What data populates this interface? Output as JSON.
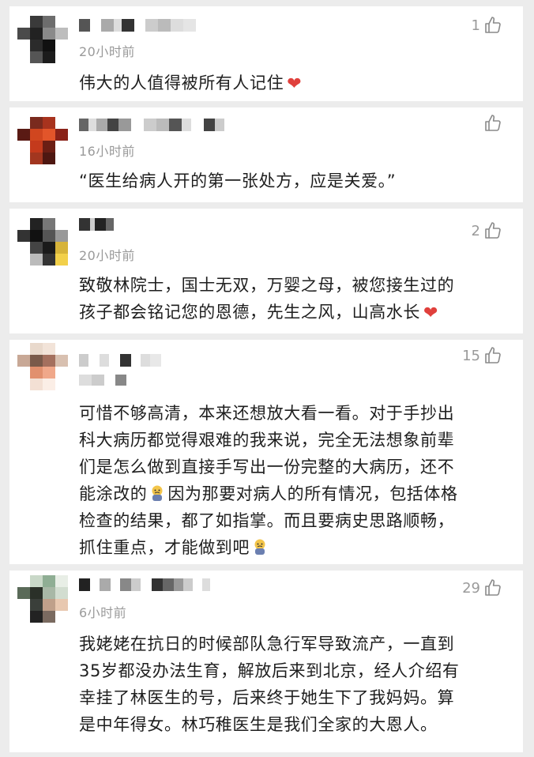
{
  "comments": [
    {
      "time": "20小时前",
      "likes": "1",
      "text": "伟大的人值得被所有人记住",
      "emoji_after": "heart-icon"
    },
    {
      "time": "16小时前",
      "likes": "",
      "text": "“医生给病人开的第一张处方，应是关爱。”"
    },
    {
      "time": "20小时前",
      "likes": "2",
      "text_line1": "致敬林院士，国士无双，万婴之母，被您接生过的",
      "text_line2": "孩子都会铭记您的恩德，先生之风，山高水长",
      "emoji_after": "heart-icon"
    },
    {
      "time": "",
      "likes": "15",
      "lines": [
        "可惜不够高清，本来还想放大看一看。对于手抄出",
        "科大病历都觉得艰难的我来说，完全无法想象前辈",
        "们是怎么做到直接手写出一份完整的大病历，还不",
        "能涂改的",
        "因为那要对病人的所有情况，包括体格",
        "检查的结果，都了如指掌。而且要病史思路顺畅，",
        "抓住重点，才能做到吧"
      ]
    },
    {
      "time": "6小时前",
      "likes": "29",
      "lines": [
        "我姥姥在抗日的时候部队急行军导致流产，一直到",
        "35岁都没办法生育，解放后来到北京，经人介绍有",
        "幸挂了林医生的号，后来终于她生下了我妈妈。算",
        "是中年得女。林巧稚医生是我们全家的大恩人。"
      ]
    }
  ],
  "icons": {
    "like": "thumbs-up-icon",
    "heart": "heart-icon",
    "cry": "crying-emoji-icon"
  },
  "colors": {
    "background": "#ececec",
    "card": "#ffffff",
    "meta": "#9a9a9a",
    "text": "#1e1e1e",
    "heart": "#e0403c"
  }
}
